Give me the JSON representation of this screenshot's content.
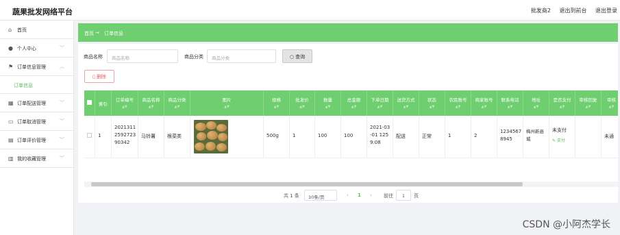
{
  "header": {
    "title": "蔬果批发网络平台",
    "user": "批发商2",
    "to_front": "退出到前台",
    "logout": "退出登录"
  },
  "sidebar": {
    "items": [
      {
        "icon": "home-icon",
        "label": "首页"
      },
      {
        "icon": "user-icon",
        "label": "个人中心"
      },
      {
        "icon": "flag-icon",
        "label": "订单信息管理"
      },
      {
        "icon": "none",
        "label": "订单信息"
      },
      {
        "icon": "bank-icon",
        "label": "订单配送管理"
      },
      {
        "icon": "message-icon",
        "label": "订单取消管理"
      },
      {
        "icon": "chart-icon",
        "label": "订单评价管理"
      },
      {
        "icon": "bar-icon",
        "label": "我的收藏管理"
      }
    ]
  },
  "breadcrumb": {
    "home": "首页",
    "arrow": "→",
    "current": "订单信息"
  },
  "search": {
    "name_label": "商品名称",
    "name_placeholder": "商品名称",
    "category_label": "商品分类",
    "category_placeholder": "商品分类",
    "button": "查询"
  },
  "actions": {
    "delete": "删除"
  },
  "table": {
    "headers": [
      "索引",
      "订单编号",
      "商品名称",
      "商品分类",
      "图片",
      "规格",
      "批发价",
      "数量",
      "总金额",
      "下单日期",
      "送货方式",
      "状态",
      "农民账号",
      "商家账号",
      "联系电话",
      "地址",
      "是否支付",
      "审核回复",
      "审核"
    ],
    "row": {
      "index": "1",
      "order_no": "2021311 2592723 90342",
      "name": "马铃薯",
      "category": "根菜类",
      "spec": "500g",
      "price": "1",
      "qty": "100",
      "total": "100",
      "date": "2021-03 -01 125 9:08",
      "delivery": "配送",
      "status": "正常",
      "farmer": "1",
      "merchant": "2",
      "phone": "1234567 8945",
      "address": "梅州新县城",
      "paid": "未支付",
      "pay_link": "支付",
      "reply": "",
      "review": "未通"
    }
  },
  "pagination": {
    "total": "共 1 条",
    "page_size": "10条/页",
    "current": "1",
    "goto_label": "前往",
    "goto_value": "1",
    "page_suffix": "页"
  },
  "watermark": "CSDN @小阿杰学长",
  "colors": {
    "accent": "#6fce6f",
    "danger": "#e06060"
  }
}
